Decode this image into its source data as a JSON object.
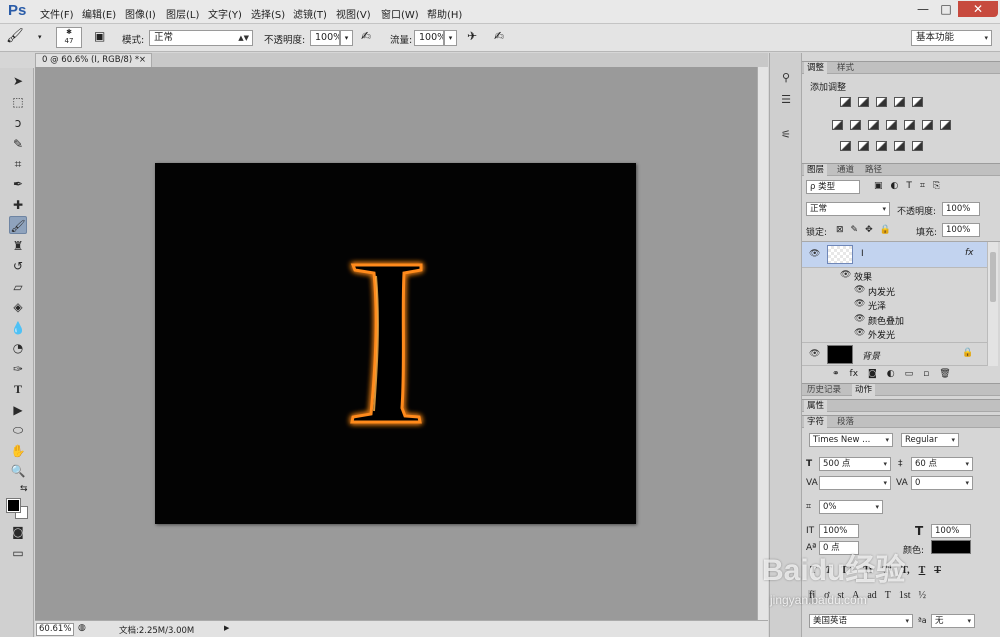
{
  "app": {
    "logo": "Ps",
    "window_controls": [
      "—",
      "□",
      "✕"
    ]
  },
  "menus": [
    "文件(F)",
    "编辑(E)",
    "图像(I)",
    "图层(L)",
    "文字(Y)",
    "选择(S)",
    "滤镜(T)",
    "视图(V)",
    "窗口(W)",
    "帮助(H)"
  ],
  "options": {
    "brush_size": "47",
    "mode_label": "模式:",
    "mode_value": "正常",
    "opacity_label": "不透明度:",
    "opacity_value": "100%",
    "flow_label": "流量:",
    "flow_value": "100%",
    "workspace": "基本功能"
  },
  "document": {
    "tab_title": "0 @ 60.6% (I, RGB/8) *",
    "tab_close": "×",
    "letter": "I",
    "canvas_bg": "#000000",
    "glow_color": "#ff8a1a"
  },
  "status": {
    "zoom": "60.61%",
    "doc_info": "文档:2.25M/3.00M"
  },
  "panels": {
    "adjust": {
      "tabs": [
        "调整",
        "样式"
      ],
      "title": "添加调整"
    },
    "layers": {
      "tabs": [
        "图层",
        "通道",
        "路径"
      ],
      "filter": "ρ 类型",
      "blend": "正常",
      "opacity_label": "不透明度:",
      "opacity": "100%",
      "lock_label": "锁定:",
      "fill_label": "填充:",
      "fill": "100%",
      "layer_text_name": "I",
      "layer_fx": "fx",
      "effects_label": "效果",
      "effects": [
        "内发光",
        "光泽",
        "颜色叠加",
        "外发光"
      ],
      "bg_layer": "背景",
      "lock_icon": "🔒"
    },
    "history": {
      "tabs": [
        "历史记录",
        "动作"
      ]
    },
    "properties": {
      "title": "属性"
    },
    "character": {
      "tabs": [
        "字符",
        "段落"
      ],
      "font_family": "Times New ...",
      "font_style": "Regular",
      "size": "500 点",
      "leading": "60 点",
      "kerning": "",
      "tracking": "0",
      "scale_pct": "0%",
      "v_scale": "100%",
      "h_scale": "100%",
      "baseline": "0 点",
      "color_label": "颜色:",
      "language": "美国英语",
      "aa": "无",
      "tt_buttons": [
        "T",
        "T",
        "TT",
        "Tr",
        "T¹",
        "T,",
        "T",
        "T"
      ],
      "ot_buttons": [
        "fi",
        "ơ",
        "st",
        "A",
        "ad",
        "T",
        "1st",
        "½"
      ]
    }
  },
  "watermark": {
    "brand": "Baidu经验",
    "url": "jingyan.baidu.com"
  }
}
